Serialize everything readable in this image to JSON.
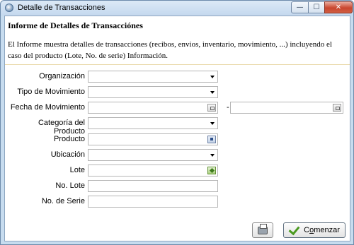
{
  "window": {
    "title": "Detalle de Transacciones",
    "minimize_glyph": "—",
    "maximize_glyph": "☐",
    "close_glyph": "✕"
  },
  "header": {
    "title": "Informe de Detalles de Transacciónes",
    "description": "El Informe muestra detalles de transacciones (recibos, envios, inventario, movimiento, ...) incluyendo el caso del producto (Lote, No. de serie) Información."
  },
  "form": {
    "fields": [
      {
        "label": "Organización",
        "value": "",
        "kind": "dropdown"
      },
      {
        "label": "Tipo de Movimiento",
        "value": "",
        "kind": "dropdown"
      },
      {
        "label": "Fecha de Movimiento",
        "value": "",
        "value_to": "",
        "kind": "date-range",
        "separator": "-"
      },
      {
        "label": "Categoría del Producto",
        "value": "",
        "kind": "dropdown"
      },
      {
        "label": "Producto",
        "value": "",
        "kind": "search"
      },
      {
        "label": "Ubicación",
        "value": "",
        "kind": "dropdown"
      },
      {
        "label": "Lote",
        "value": "",
        "kind": "lot-search"
      },
      {
        "label": "No. Lote",
        "value": "",
        "kind": "text"
      },
      {
        "label": "No. de Serie",
        "value": "",
        "kind": "text"
      }
    ]
  },
  "actions": {
    "start_label_prefix": "C",
    "start_label_underlined": "o",
    "start_label_suffix": "menzar",
    "print_icon": "printer-icon",
    "start_icon": "check-icon"
  },
  "colors": {
    "titlebar": "#c4d8ee",
    "close_button": "#c9462e",
    "header_rule": "#e9d8a8",
    "check_green": "#4a9a1f"
  }
}
